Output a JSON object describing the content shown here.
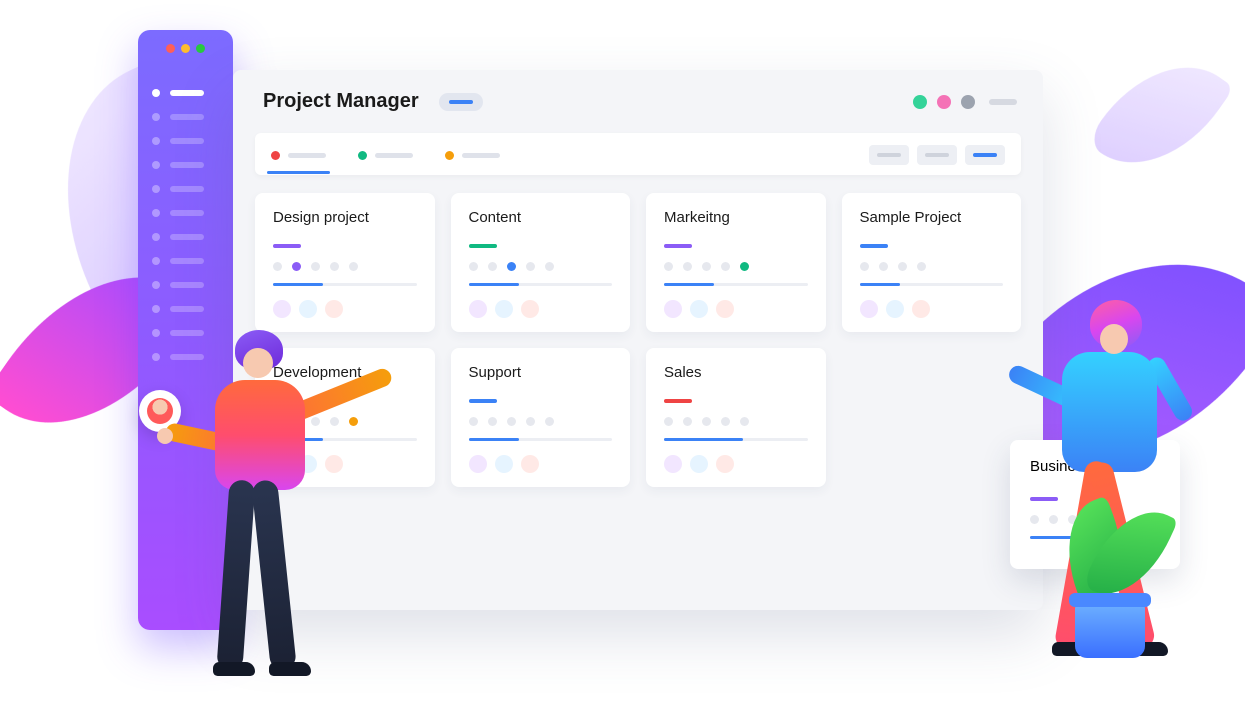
{
  "header": {
    "title": "Project Manager"
  },
  "toolbar": {
    "tabs": [
      {
        "color": "#ef4444",
        "active": true
      },
      {
        "color": "#10b981",
        "active": false
      },
      {
        "color": "#f59e0b",
        "active": false
      }
    ]
  },
  "projects": [
    {
      "title": "Design project",
      "accent": "#8b5cf6",
      "highlight_dot_index": 1,
      "highlight_color": "#8b5cf6",
      "progress": 35
    },
    {
      "title": "Content",
      "accent": "#10b981",
      "highlight_dot_index": 2,
      "highlight_color": "#3b82f6",
      "progress": 35
    },
    {
      "title": "Markeitng",
      "accent": "#8b5cf6",
      "highlight_dot_index": 4,
      "highlight_color": "#10b981",
      "progress": 35
    },
    {
      "title": "Sample Project",
      "accent": "#3b82f6",
      "highlight_dot_index": -1,
      "highlight_color": "",
      "progress": 28
    },
    {
      "title": "Development",
      "accent": "#14b8a6",
      "highlight_dot_index": 4,
      "highlight_color": "#f59e0b",
      "progress": 35
    },
    {
      "title": "Support",
      "accent": "#3b82f6",
      "highlight_dot_index": -1,
      "highlight_color": "",
      "progress": 35
    },
    {
      "title": "Sales",
      "accent": "#ef4444",
      "highlight_dot_index": -1,
      "highlight_color": "",
      "progress": 55
    }
  ],
  "float_card": {
    "title": "Business Team",
    "accent": "#8b5cf6",
    "progress": 35
  }
}
